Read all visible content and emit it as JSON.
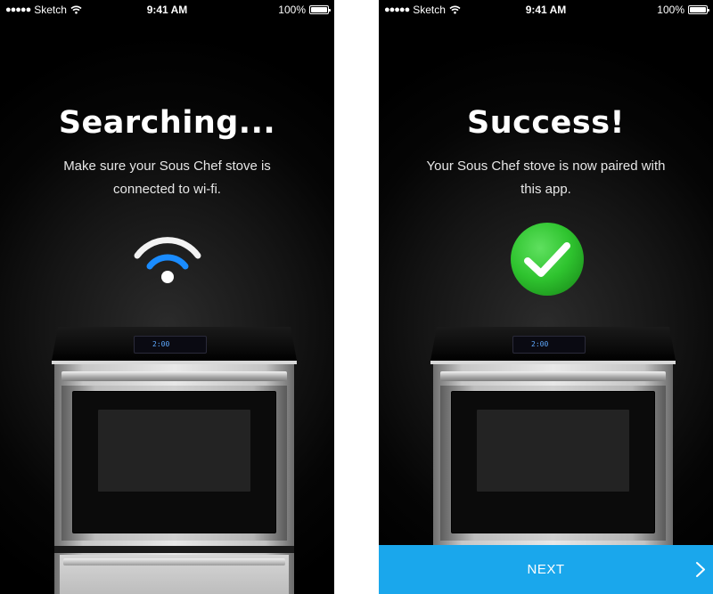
{
  "status_bar": {
    "carrier": "Sketch",
    "time": "9:41 AM",
    "battery": "100%",
    "battery_level": 1.0
  },
  "screens": [
    {
      "title": "Searching...",
      "subtitle": "Make sure your Sous Chef stove is connected to wi-fi.",
      "icon": "wifi-icon",
      "stove_display": "2:00"
    },
    {
      "title": "Success!",
      "subtitle": "Your Sous Chef stove is now paired with this app.",
      "icon": "checkmark-icon",
      "stove_display": "2:00",
      "next_label": "NEXT"
    }
  ],
  "colors": {
    "accent_blue": "#1aa7ec",
    "wifi_blue": "#1a8cff",
    "success_green": "#2fc42f"
  }
}
